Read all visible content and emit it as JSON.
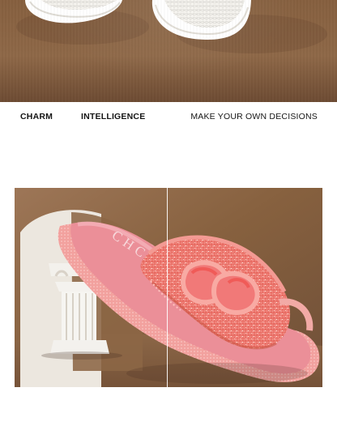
{
  "tagline": {
    "left": "CHARM",
    "middle": "INTELLIGENCE",
    "right": "MAKE YOUR OWN DECISIONS"
  },
  "product": {
    "insole_brand": "CHCH"
  },
  "colors": {
    "background": "#ffffff",
    "top_backdrop": "#8d6848",
    "product_backdrop": "#8a6548",
    "sandal_pink": "#ea8d96",
    "tweed_orange": "#ec6b5b",
    "plinth_white": "#f2f0eb",
    "text": "#151515"
  },
  "icons": {
    "top_image": "white-sandal-pair",
    "product_image": "pink-tweed-slide-sandal",
    "decor": "greek-column-plinth"
  }
}
